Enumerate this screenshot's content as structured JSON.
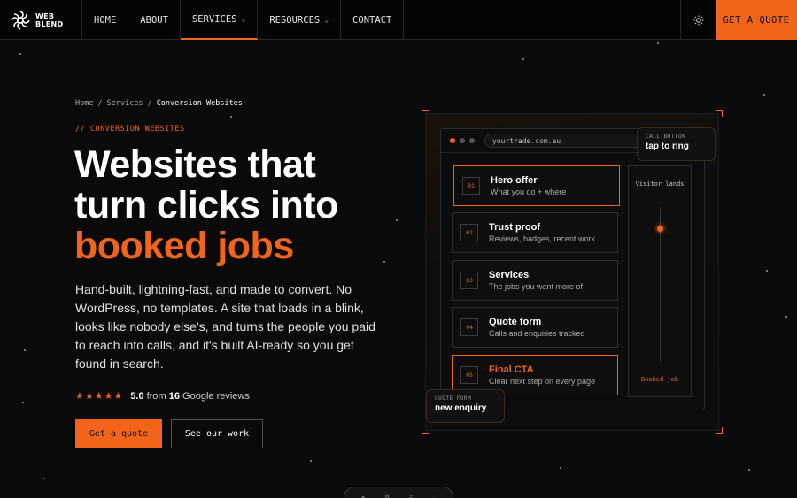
{
  "nav": {
    "logo_line1": "WEB",
    "logo_line2": "BLEND",
    "items": [
      {
        "label": "HOME"
      },
      {
        "label": "ABOUT"
      },
      {
        "label": "SERVICES"
      },
      {
        "label": "RESOURCES"
      },
      {
        "label": "CONTACT"
      }
    ],
    "cta": "GET A QUOTE",
    "theme_icon": "sun-icon"
  },
  "breadcrumb": {
    "home": "Home",
    "sep": "/",
    "services": "Services",
    "current": "Conversion Websites"
  },
  "hero": {
    "eyebrow": "// CONVERSION WEBSITES",
    "headline_line1": "Websites that",
    "headline_line2": "turn clicks into",
    "headline_accent": "booked jobs",
    "lede": "Hand-built, lightning-fast, and made to convert. No WordPress, no templates. A site that loads in a blink, looks like nobody else's, and turns the people you paid to reach into calls, and it's built AI-ready so you get found in search.",
    "stars": "★★★★★",
    "rating_score": "5.0",
    "rating_from": "from",
    "rating_count": "16",
    "rating_source": "Google reviews",
    "primary_button": "Get a quote",
    "secondary_button": "See our work"
  },
  "mockup": {
    "url": "yourtrade.com.au",
    "sections": [
      {
        "num": "01",
        "title": "Hero offer",
        "sub": "What you do + where"
      },
      {
        "num": "02",
        "title": "Trust proof",
        "sub": "Reviews, badges, recent work"
      },
      {
        "num": "03",
        "title": "Services",
        "sub": "The jobs you want more of"
      },
      {
        "num": "04",
        "title": "Quote form",
        "sub": "Calls and enquiries tracked"
      },
      {
        "num": "05",
        "title": "Final CTA",
        "sub": "Clear next step on every page"
      }
    ],
    "side_top": "Visitor lands",
    "side_bottom": "Booked job",
    "call_label": "CALL BUTTON",
    "call_value": "tap to ring",
    "quote_label": "QUOTE FORM",
    "quote_value": "new enquiry"
  },
  "colors": {
    "accent": "#f26419",
    "background": "#0a0a0a"
  }
}
